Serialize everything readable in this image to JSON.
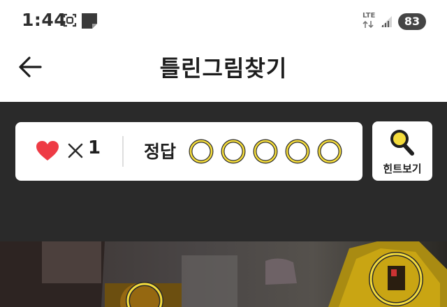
{
  "status_bar": {
    "time": "1:44",
    "network_type": "LTE",
    "battery_level": "83",
    "icons": [
      "screenshot-icon",
      "sticky-note-icon",
      "data-arrows-icon",
      "signal-icon"
    ]
  },
  "header": {
    "title": "틀린그림찾기",
    "back_icon": "back-arrow-icon"
  },
  "score_panel": {
    "lives_icon": "heart-icon",
    "lives_separator": "multiply-icon",
    "lives_count": "1",
    "answer_label": "정답",
    "answer_slots_total": 5,
    "answers_found": 0
  },
  "hint": {
    "label": "힌트보기",
    "icon": "magnifier-icon"
  },
  "colors": {
    "accent_yellow": "#f4dc3c",
    "heart_red": "#ee3b45",
    "dark_bg": "#2a2a2a",
    "panel_bg": "#ffffff"
  }
}
